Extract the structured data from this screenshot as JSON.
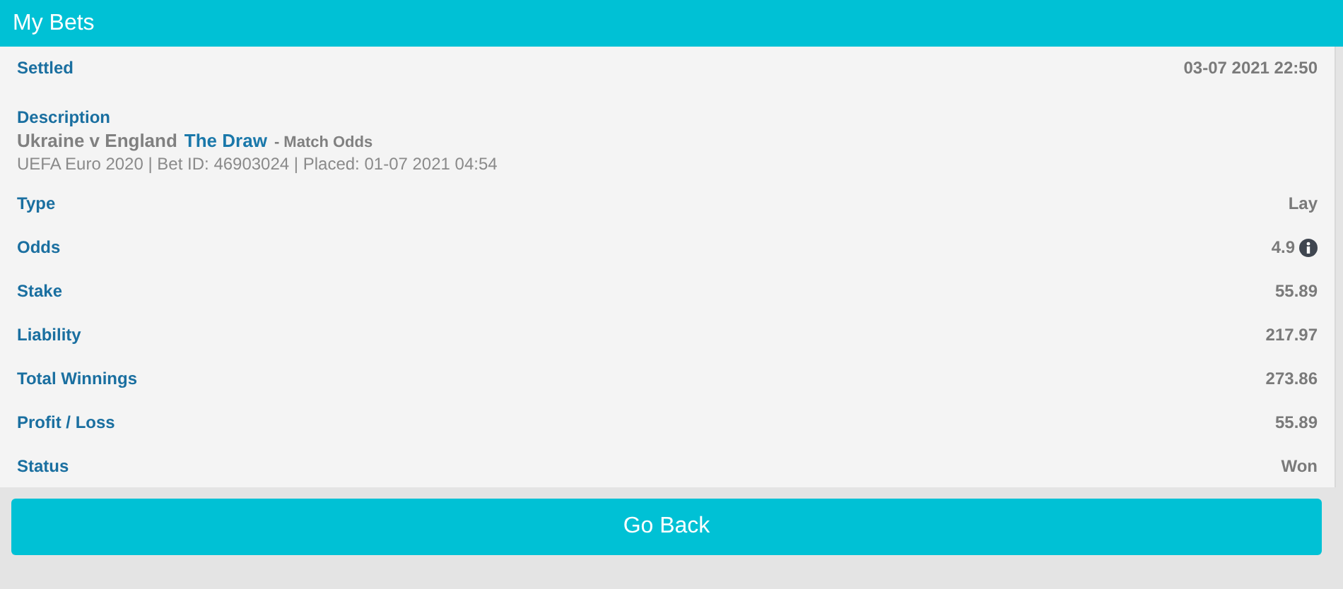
{
  "header": {
    "title": "My Bets"
  },
  "settled": {
    "label": "Settled",
    "value": "03-07 2021 22:50"
  },
  "description": {
    "label": "Description",
    "event": "Ukraine v England",
    "selection": "The Draw",
    "market": "- Match Odds",
    "details": "UEFA Euro 2020 | Bet ID: 46903024 | Placed: 01-07 2021 04:54"
  },
  "rows": [
    {
      "kind": "plain",
      "label": "Type",
      "value": "Lay"
    },
    {
      "kind": "info",
      "label": "Odds",
      "value": "4.9"
    },
    {
      "kind": "plain",
      "label": "Stake",
      "value": "55.89"
    },
    {
      "kind": "plain",
      "label": "Liability",
      "value": "217.97"
    },
    {
      "kind": "plain",
      "label": "Total Winnings",
      "value": "273.86"
    },
    {
      "kind": "plain",
      "label": "Profit / Loss",
      "value": "55.89"
    },
    {
      "kind": "plain",
      "label": "Status",
      "value": "Won"
    }
  ],
  "back_button": {
    "label": "Go Back"
  }
}
